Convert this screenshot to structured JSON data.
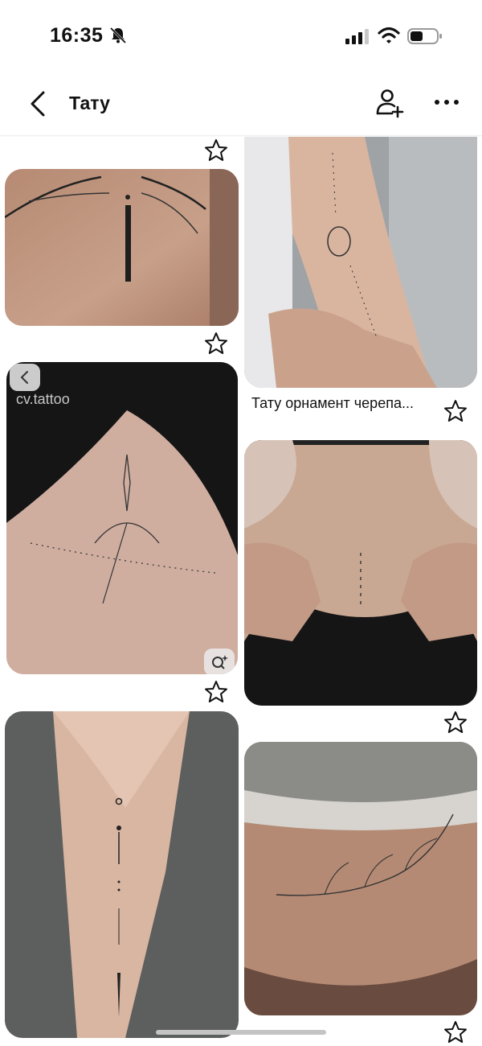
{
  "status_bar": {
    "time": "16:35",
    "icons": [
      "bell-slash-icon",
      "signal-icon",
      "wifi-icon",
      "battery-icon"
    ]
  },
  "header": {
    "title": "Тату",
    "icons": [
      "back-icon",
      "add-person-icon",
      "more-icon"
    ]
  },
  "pins": [
    {
      "column": "left",
      "has_star": true
    },
    {
      "column": "right",
      "caption": "Тату орнамент черепа...",
      "has_star": true
    },
    {
      "column": "left",
      "watermark": "cv.tattoo",
      "has_star": true
    },
    {
      "column": "right",
      "has_star": true
    },
    {
      "column": "left",
      "has_star": false
    },
    {
      "column": "right",
      "has_star": true
    }
  ],
  "colors": {
    "background": "#ffffff",
    "text": "#111111",
    "skin": "#c9a48f",
    "home_indicator": "#c4c4c4"
  }
}
